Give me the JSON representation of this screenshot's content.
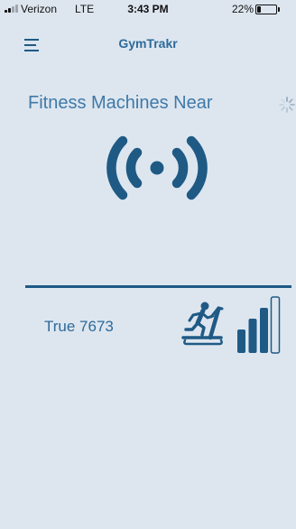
{
  "status_bar": {
    "carrier": "Verizon",
    "network": "LTE",
    "time": "3:43 PM",
    "battery_pct": "22%",
    "battery_level": 0.22,
    "signal_bars": 2
  },
  "header": {
    "menu_icon": "hamburger-menu-icon",
    "title": "GymTrakr"
  },
  "main": {
    "section_title": "Fitness Machines Near",
    "loading": true,
    "broadcast_icon": "broadcast-signal-icon",
    "machines": [
      {
        "name": "True 7673",
        "type_icon": "treadmill-icon",
        "signal_strength_bars": 3,
        "signal_strength_total": 4
      }
    ]
  },
  "colors": {
    "background": "#dde6ef",
    "accent": "#1f5a85",
    "text": "#2d6a9a"
  }
}
